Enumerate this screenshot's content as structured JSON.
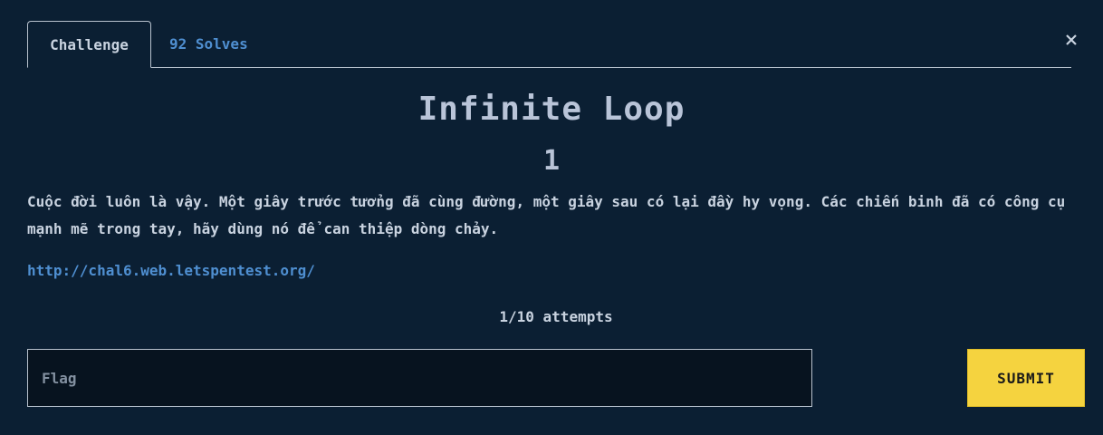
{
  "tabs": {
    "challenge_label": "Challenge",
    "solves_label": "92 Solves"
  },
  "challenge": {
    "name": "Infinite Loop",
    "value": "1",
    "description": "Cuộc đời luôn là vậy. Một giây trước tưởng đã cùng đường, một giây sau có lại đầy hy vọng. Các chiến binh đã có công cụ mạnh mẽ trong tay, hãy dùng nó để can thiệp dòng chảy.",
    "link": "http://chal6.web.letspentest.org/",
    "attempts": "1/10 attempts"
  },
  "form": {
    "flag_placeholder": "Flag",
    "flag_value": "",
    "submit_label": "SUBMIT"
  },
  "colors": {
    "background": "#0b1f33",
    "accent": "#4f8fd1",
    "submit": "#f5d33f"
  },
  "icons": {
    "close": "close-icon"
  }
}
